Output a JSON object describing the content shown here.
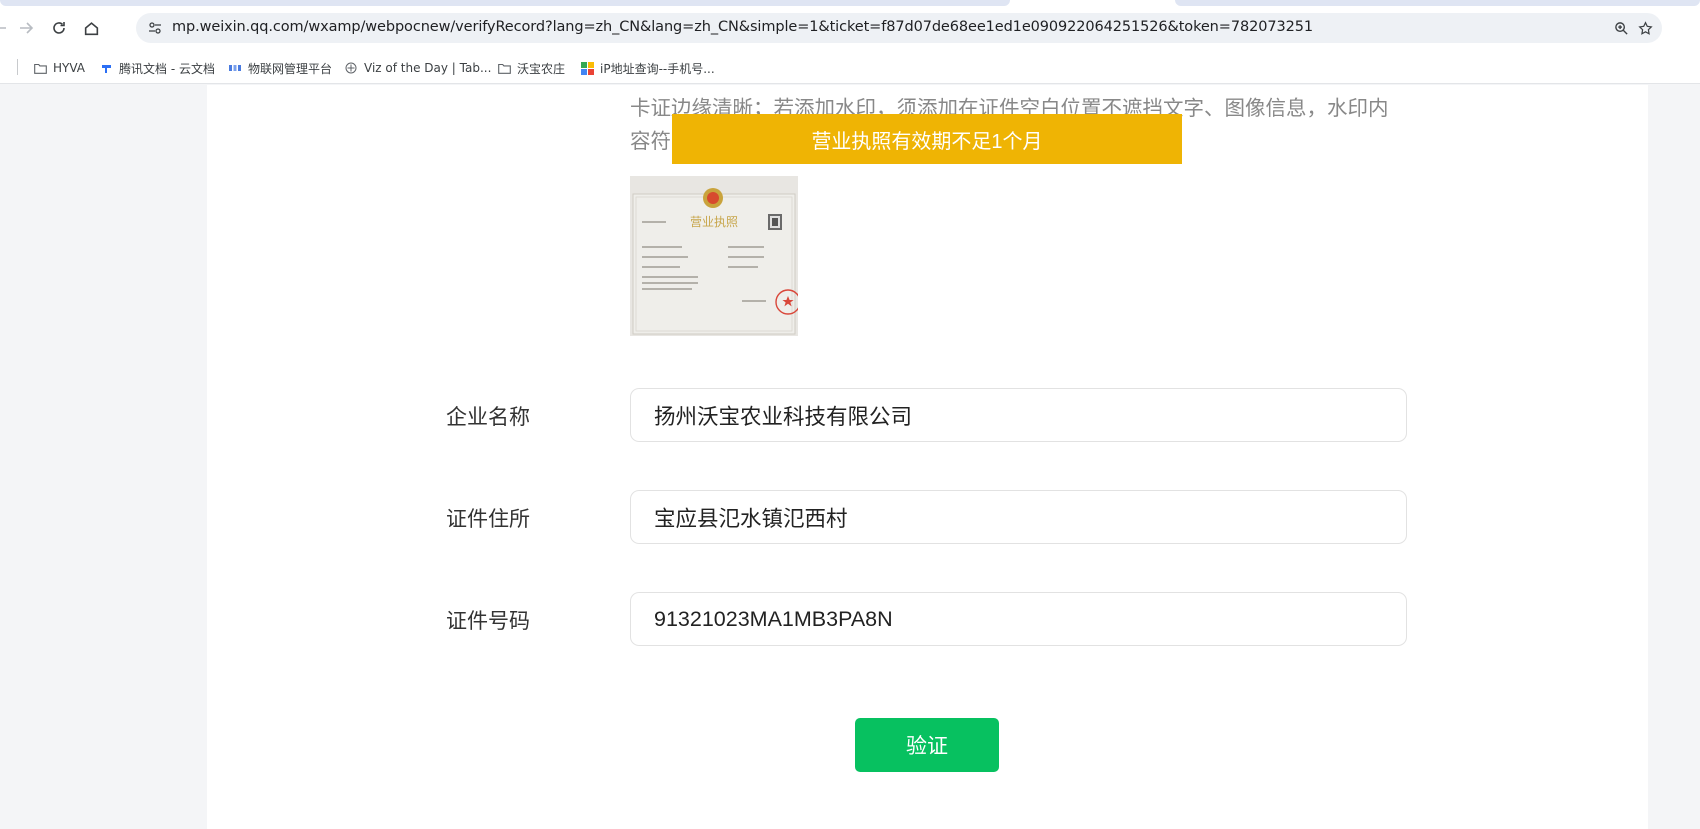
{
  "browser": {
    "url": "mp.weixin.qq.com/wxamp/webpocnew/verifyRecord?lang=zh_CN&lang=zh_CN&simple=1&ticket=f87d07de68ee1ed1e090922064251526&token=782073251",
    "bookmarks": [
      {
        "label": "HYVA",
        "icon": "folder-icon"
      },
      {
        "label": "腾讯文档 - 云文档",
        "icon": "tencent-docs-icon"
      },
      {
        "label": "物联网管理平台",
        "icon": "iot-platform-icon"
      },
      {
        "label": "Viz of the Day | Tab...",
        "icon": "tableau-icon"
      },
      {
        "label": "沃宝农庄",
        "icon": "folder-icon"
      },
      {
        "label": "iP地址查询--手机号...",
        "icon": "ip-lookup-icon"
      }
    ]
  },
  "page": {
    "hint_line1": "卡证边缘清晰；若添加水印，须添加在证件空白位置不遮挡文字、图像信息，水印内",
    "hint_line2": "容符",
    "toast": "营业执照有效期不足1个月",
    "license_title": "营业执照",
    "form": {
      "company_name_label": "企业名称",
      "company_name_value": "扬州沃宝农业科技有限公司",
      "address_label": "证件住所",
      "address_value": "宝应县氾水镇氾西村",
      "number_label": "证件号码",
      "number_value": "91321023MA1MB3PA8N"
    },
    "verify_button": "验证"
  },
  "colors": {
    "toast_bg": "#efb404",
    "verify_bg": "#07c160",
    "page_bg": "#f4f5f7"
  }
}
